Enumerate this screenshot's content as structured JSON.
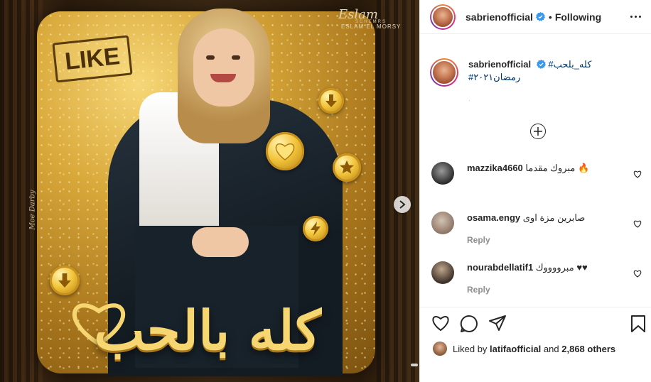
{
  "post_image": {
    "like_badge": "LIKE",
    "title_calligraphy": "كله بالحب",
    "signature_line1": "Eslam",
    "signature_line2": "SCHEMRS",
    "signature_line3": "ESLAM EL MORSY",
    "side_signature": "Moe Darby"
  },
  "header": {
    "username": "sabrienofficial",
    "separator": "•",
    "follow_label": "Following"
  },
  "caption": {
    "username": "sabrienofficial",
    "hashtag1": "#كله_بلحب",
    "hashtag2": "#رمضان٢٠٢١",
    "dot": "."
  },
  "comments": [
    {
      "username": "mazzika4660",
      "text": "مبروك مقدما 🔥",
      "meta": ""
    },
    {
      "username": "osama.engy",
      "text": "صابرين مزة اوى",
      "reply_label": "Reply"
    },
    {
      "username": "nourabdellatif1",
      "text": "مبرووووك ♥♥",
      "reply_label": "Reply"
    }
  ],
  "likes": {
    "prefix": "Liked by",
    "user": "latifaofficial",
    "suffix_and": "and",
    "count_text": "2,868 others"
  },
  "colors": {
    "gold": "#f2c43a",
    "hashtag": "#00376b",
    "verified": "#3897f0",
    "muted": "#8e8e8e"
  }
}
